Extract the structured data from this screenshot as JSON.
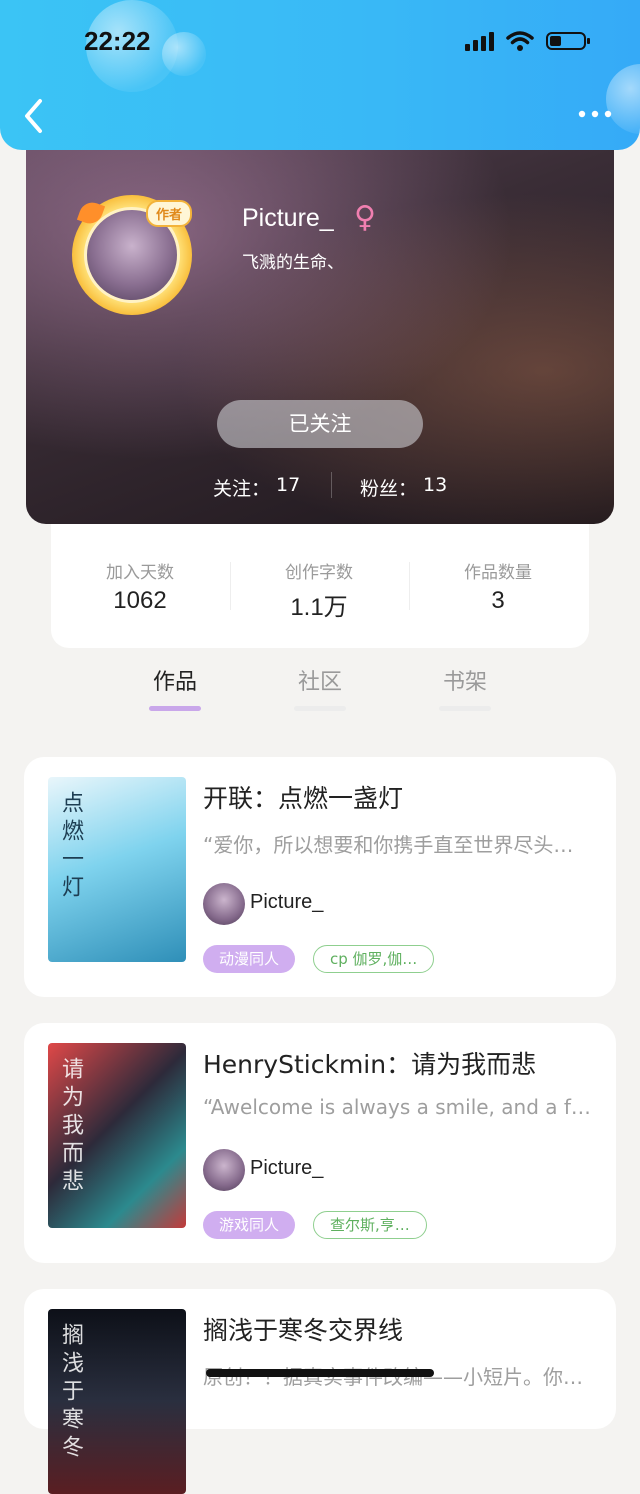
{
  "status_bar": {
    "time": "22:22"
  },
  "profile": {
    "badge": "作者",
    "username": "Picture_",
    "gender_symbol": "♀",
    "motto": "飞溅的生命、",
    "follow_button": "已关注",
    "following_label": "关注：",
    "following_count": "17",
    "fans_label": "粉丝：",
    "fans_count": "13"
  },
  "stats": [
    {
      "label": "加入天数",
      "value": "1062"
    },
    {
      "label": "创作字数",
      "value": "1.1万"
    },
    {
      "label": "作品数量",
      "value": "3"
    }
  ],
  "tabs": [
    {
      "label": "作品",
      "active": true
    },
    {
      "label": "社区",
      "active": false
    },
    {
      "label": "书架",
      "active": false
    }
  ],
  "works": [
    {
      "title": "开联：点燃一盏灯",
      "desc": "“爱你，所以想要和你携手直至世界尽头…",
      "author": "Picture_",
      "tag_primary": "动漫同人",
      "tag_secondary": "cp 伽罗,伽…",
      "cover_text": "点燃一灯"
    },
    {
      "title": "HenryStickmin：请为我而悲",
      "desc": "“Awelcome is always a smile, and a fare…",
      "author": "Picture_",
      "tag_primary": "游戏同人",
      "tag_secondary": "查尔斯,亨…",
      "cover_text": "请为我而悲"
    },
    {
      "title": "搁浅于寒冬交界线",
      "desc": "原创！！据真实事件改编——小短片。你…",
      "author": "",
      "tag_primary": "",
      "tag_secondary": "",
      "cover_text": "搁浅于寒冬"
    }
  ]
}
